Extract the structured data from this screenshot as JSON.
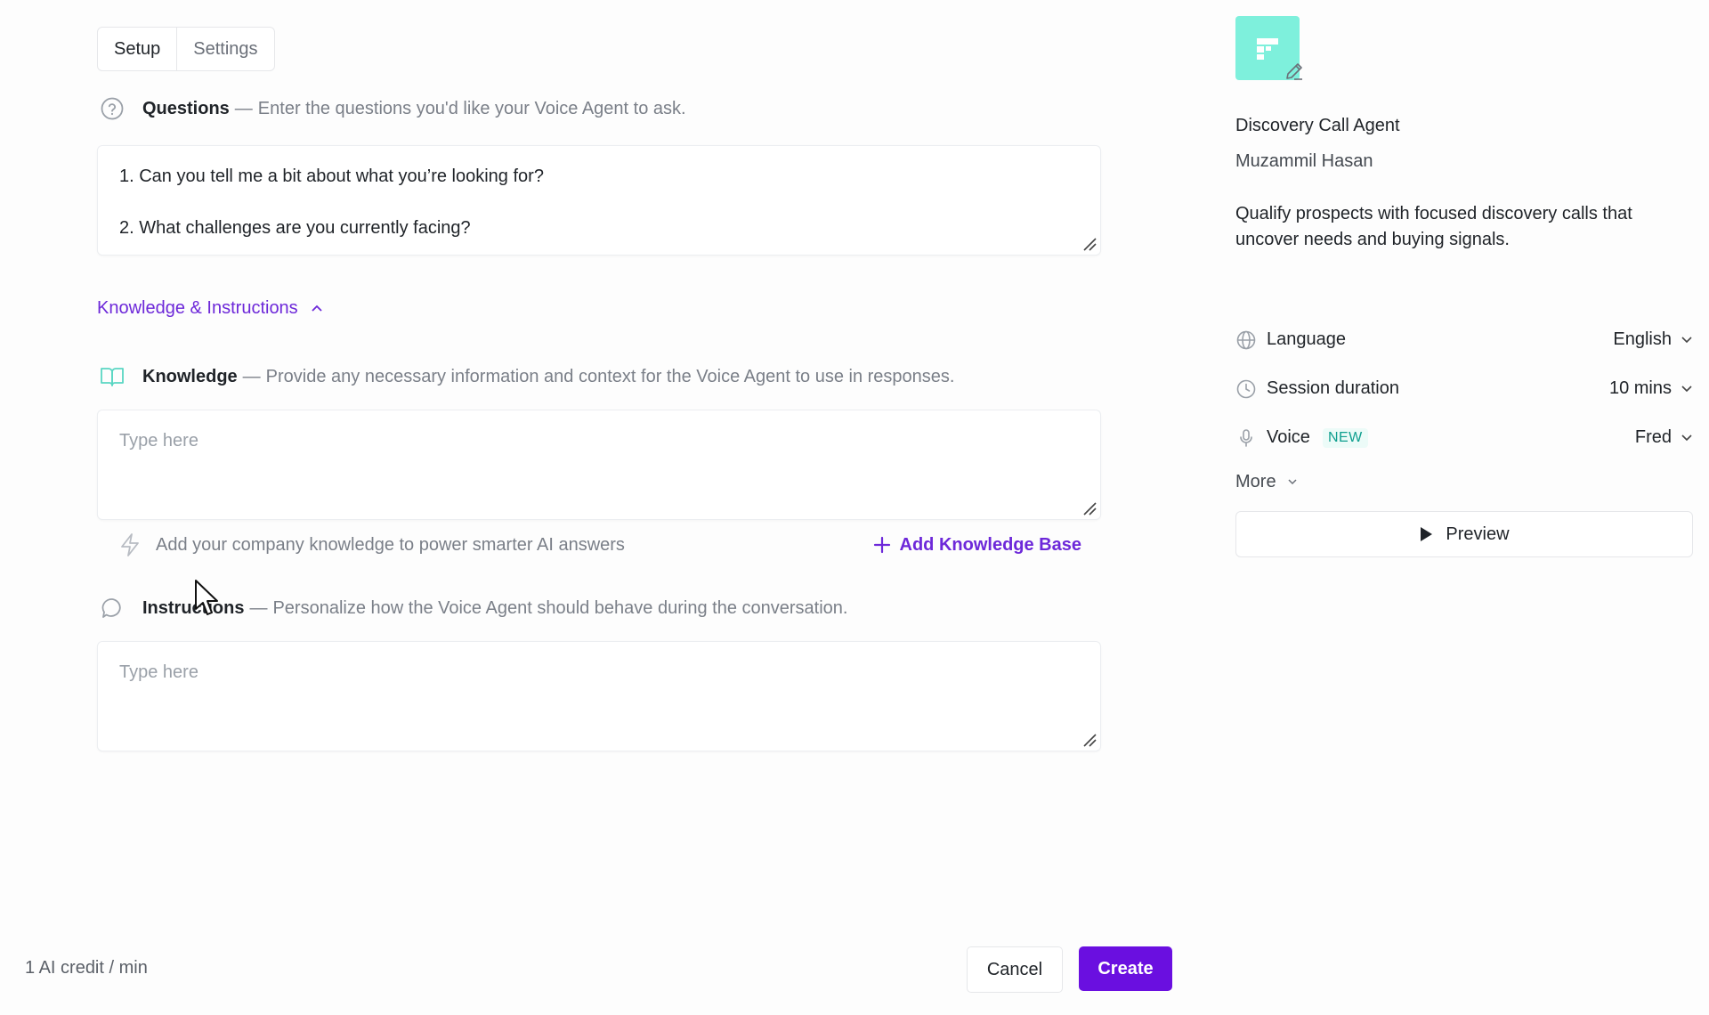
{
  "tabs": [
    {
      "label": "Setup",
      "active": true
    },
    {
      "label": "Settings",
      "active": false
    }
  ],
  "questions": {
    "title": "Questions",
    "description": "Enter the questions you'd like your Voice Agent to ask.",
    "items": [
      "1. Can you tell me a bit about what you’re looking for?",
      "2. What challenges are you currently facing?"
    ]
  },
  "knowledge_section": {
    "toggle_label": "Knowledge & Instructions",
    "expanded": true
  },
  "knowledge": {
    "title": "Knowledge",
    "description": "Provide any necessary information and context for the Voice Agent to use in responses.",
    "placeholder": "Type here",
    "hint": "Add your company knowledge to power smarter AI answers",
    "add_button": "Add Knowledge Base"
  },
  "instructions": {
    "title": "Instructions",
    "description": "Personalize how the Voice Agent should behave during the conversation.",
    "placeholder": "Type here"
  },
  "agent": {
    "name": "Discovery Call Agent",
    "owner": "Muzammil Hasan",
    "description": "Qualify prospects with focused discovery calls that uncover needs and buying signals.",
    "logo_color": "#7ef0dc"
  },
  "options": {
    "language": {
      "label": "Language",
      "value": "English",
      "icon": "globe-icon"
    },
    "session_duration": {
      "label": "Session duration",
      "value": "10 mins",
      "icon": "clock-icon"
    },
    "voice": {
      "label": "Voice",
      "badge": "NEW",
      "value": "Fred",
      "icon": "microphone-icon"
    },
    "more_label": "More"
  },
  "preview_button": "Preview",
  "footer": {
    "credit": "1 AI credit / min",
    "cancel": "Cancel",
    "create": "Create"
  },
  "colors": {
    "accent": "#6d28d9",
    "primary_button": "#6a0fe0",
    "badge_text": "#0f9f8f"
  }
}
